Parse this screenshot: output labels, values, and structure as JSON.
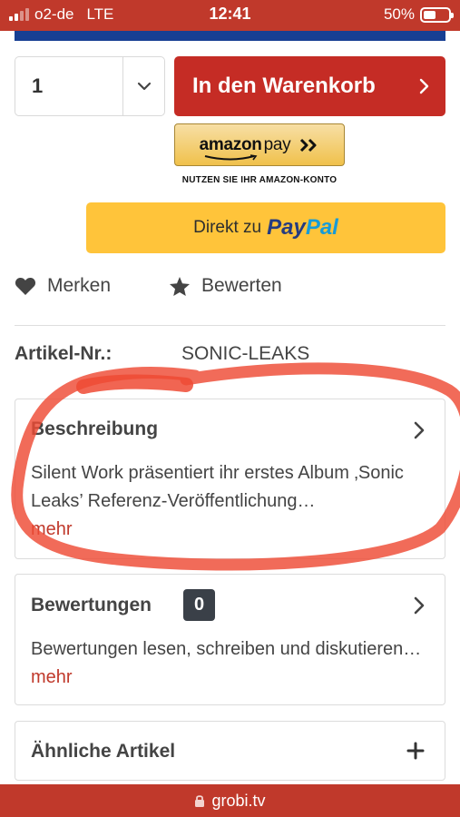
{
  "status_bar": {
    "carrier": "o2-de",
    "network": "LTE",
    "time": "12:41",
    "battery": "50%",
    "battery_level": 0.5
  },
  "product": {
    "quantity": "1",
    "cart_button_label": "In den Warenkorb",
    "amazon_pay": {
      "brand": "amazon",
      "pay": "pay",
      "note": "NUTZEN SIE IHR AMAZON-KONTO"
    },
    "paypal": {
      "prefix": "Direkt zu",
      "logo_part1": "Pay",
      "logo_part2": "Pal"
    },
    "actions": {
      "merken": "Merken",
      "bewerten": "Bewerten"
    },
    "article_label": "Artikel-Nr.:",
    "article_number": "SONIC-LEAKS"
  },
  "sections": {
    "description": {
      "title": "Beschreibung",
      "text": "Silent Work präsentiert ihr erstes Album ‚Sonic Leaks’ Referenz-Veröffentlichung…",
      "more": "mehr"
    },
    "reviews": {
      "title": "Bewertungen",
      "count": "0",
      "text": "Bewertungen lesen, schreiben und diskutieren…",
      "more": "mehr"
    },
    "similar": {
      "title": "Ähnliche Artikel"
    }
  },
  "url_bar": {
    "domain": "grobi.tv"
  },
  "colors": {
    "brand_red": "#c0392b",
    "paypal_yellow": "#ffc43a",
    "amazon_gold": "#f0c14b",
    "navy": "#173f93"
  },
  "icons": [
    "heart-icon",
    "star-icon",
    "chevron-down-icon",
    "chevron-right-icon",
    "plus-icon",
    "lock-icon"
  ]
}
